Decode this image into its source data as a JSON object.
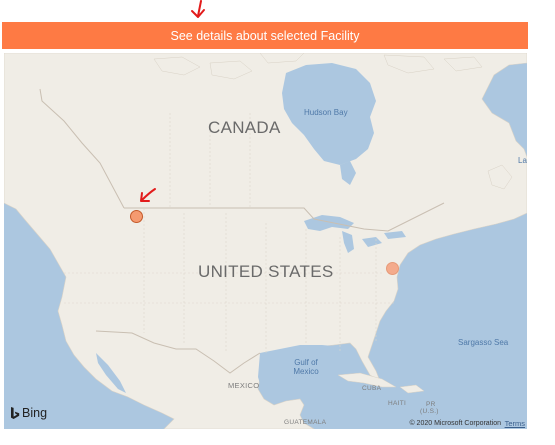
{
  "action_bar": {
    "label": "See details about selected Facility",
    "color": "#fe7a44"
  },
  "map": {
    "country_labels": {
      "canada": "CANADA",
      "united_states": "UNITED STATES",
      "mexico": "MEXICO"
    },
    "water_labels": {
      "hudson_bay": "Hudson Bay",
      "gulf_of_mexico": "Gulf of Mexico",
      "sargasso_sea": "Sargasso Sea",
      "edge_fragment": "La"
    },
    "small_labels": {
      "cuba": "CUBA",
      "haiti": "HAITI",
      "pr": "PR",
      "us": "(U.S.)",
      "guatemala": "GUATEMALA"
    },
    "colors": {
      "water": "#acc7e0",
      "land": "#f0ede6",
      "primary_pin": "#f59a70",
      "secondary_pin": "#f4ab8c"
    },
    "pins": [
      {
        "name": "facility-pin-pacific-northwest",
        "selected": true
      },
      {
        "name": "facility-pin-east-coast",
        "selected": false
      }
    ],
    "attribution": {
      "logo_icon": "bing-icon",
      "logo_text": "Bing",
      "copyright": "© 2020 Microsoft Corporation",
      "terms": "Terms"
    }
  },
  "annotations": {
    "color": "#e21b1b",
    "icons": [
      "red-arrow-icon",
      "red-arrow-icon"
    ]
  }
}
